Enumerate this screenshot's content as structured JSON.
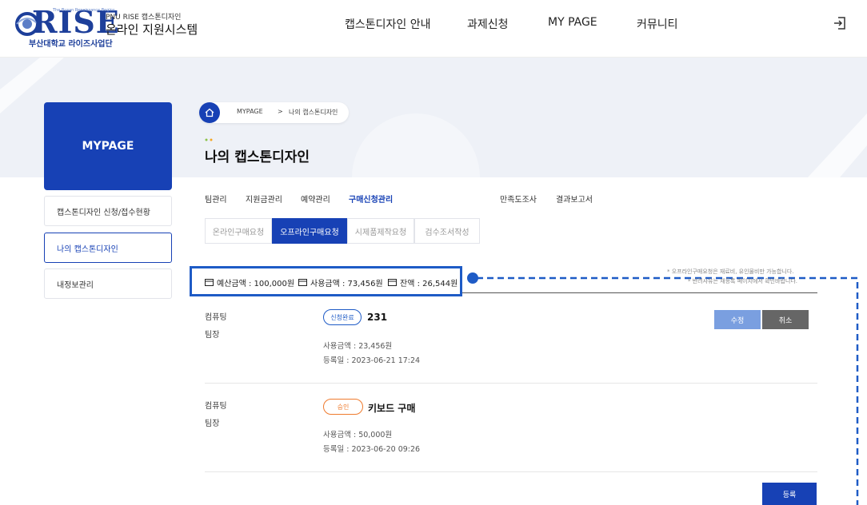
{
  "header": {
    "logo_word": "RISE",
    "logo_tagline": "The Busan Renaissance Begins",
    "logo_org": "부산대학교 라이즈사업단",
    "logo_subtitle": "PNU RISE 캡스톤디자인",
    "logo_title": "온라인 지원시스템",
    "nav": [
      "캡스톤디자인 안내",
      "과제신청",
      "MY PAGE",
      "커뮤니티"
    ],
    "logout_icon": "logout-icon"
  },
  "sidebar": {
    "title": "MYPAGE",
    "items": [
      "캡스톤디자인 신청/접수현황",
      "나의 캡스톤디자인",
      "내정보관리"
    ],
    "active_index": 1
  },
  "breadcrumb": {
    "home_icon": "home-icon",
    "level1": "MYPAGE",
    "separator": ">",
    "level2": "나의 캡스톤디자인"
  },
  "page_title": "나의 캡스톤디자인",
  "tabs": [
    "팀관리",
    "지원금관리",
    "예약관리",
    "구매신청관리",
    "만족도조사",
    "결과보고서"
  ],
  "active_tab": "구매신청관리",
  "subtabs": [
    "온라인구매요청",
    "오프라인구매요청",
    "시제품제작요청",
    "검수조서작성"
  ],
  "active_subtab": "오프라인구매요청",
  "budget": {
    "budget": "예산금액 : 100,000원",
    "used": "사용금액 : 73,456원",
    "balance": "잔액 : 26,544원"
  },
  "notes": [
    "* 오프라인구매요청은 재료비, 유인물비만 가능합니다.",
    "* 반려사유는 재등록 페이지에서 확인바랍니다."
  ],
  "records": [
    {
      "team": "컴퓨팅",
      "role": "팀장",
      "status": "신청완료",
      "title": "231",
      "amount": "사용금액 : 23,456원",
      "date": "등록일 : 2023-06-21 17:24"
    },
    {
      "team": "컴퓨팅",
      "role": "팀장",
      "status": "승인",
      "title": "키보드 구매",
      "amount": "사용금액 : 50,000원",
      "date": "등록일 : 2023-06-20 09:26"
    }
  ],
  "buttons": {
    "edit": "수정",
    "cancel": "취소",
    "register": "등록"
  },
  "colors": {
    "primary": "#1741b5",
    "highlight": "#1e5bc6",
    "approved": "#ef7b2e",
    "edit": "#7a9fe0",
    "cancel": "#666666"
  }
}
